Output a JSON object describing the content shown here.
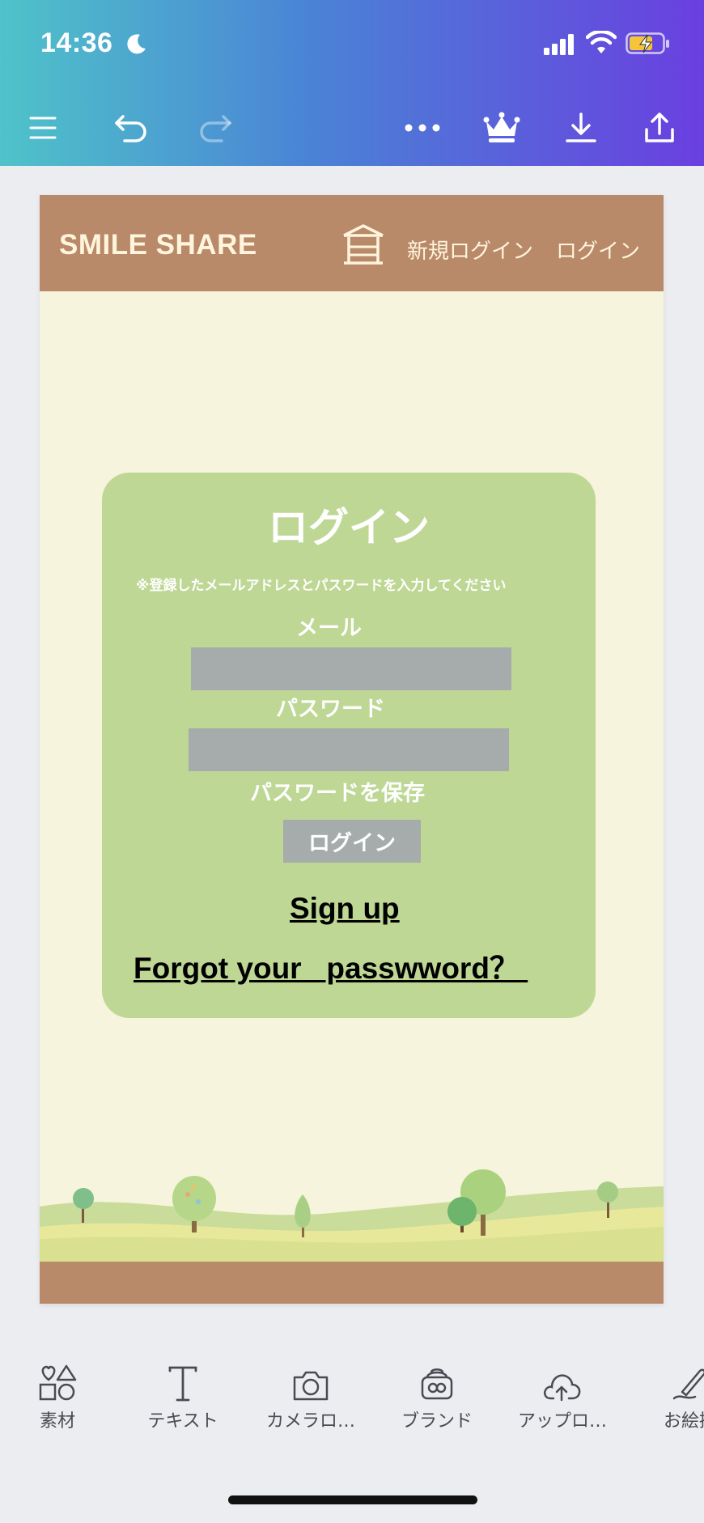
{
  "status": {
    "time": "14:36"
  },
  "toolbar": {
    "icons": [
      "menu-icon",
      "undo-icon",
      "redo-icon",
      "more-icon",
      "crown-icon",
      "download-icon",
      "share-icon"
    ]
  },
  "site": {
    "brand": "SMILE SHARE",
    "nav": [
      "新規ログイン",
      "ログイン"
    ]
  },
  "login": {
    "title": "ログイン",
    "note": "※登録したメールアドレスとパスワードを入力してください",
    "email_label": "メール",
    "password_label": "パスワード",
    "save_password_label": "パスワードを保存",
    "button_label": "ログイン",
    "signup_link": "Sign up",
    "forgot_link": "Forgot your   passwword？ "
  },
  "tray": [
    {
      "label": "素材",
      "icon": "elements-icon"
    },
    {
      "label": "テキスト",
      "icon": "text-icon"
    },
    {
      "label": "カメラロ…",
      "icon": "camera-icon"
    },
    {
      "label": "ブランド",
      "icon": "brand-icon"
    },
    {
      "label": "アップロ…",
      "icon": "upload-cloud-icon"
    },
    {
      "label": "お絵描",
      "icon": "draw-icon"
    }
  ],
  "colors": {
    "header_brown": "#b98a6a",
    "page_cream": "#f6f4dc",
    "card_green": "#bed795",
    "input_gray": "#a6abab"
  }
}
